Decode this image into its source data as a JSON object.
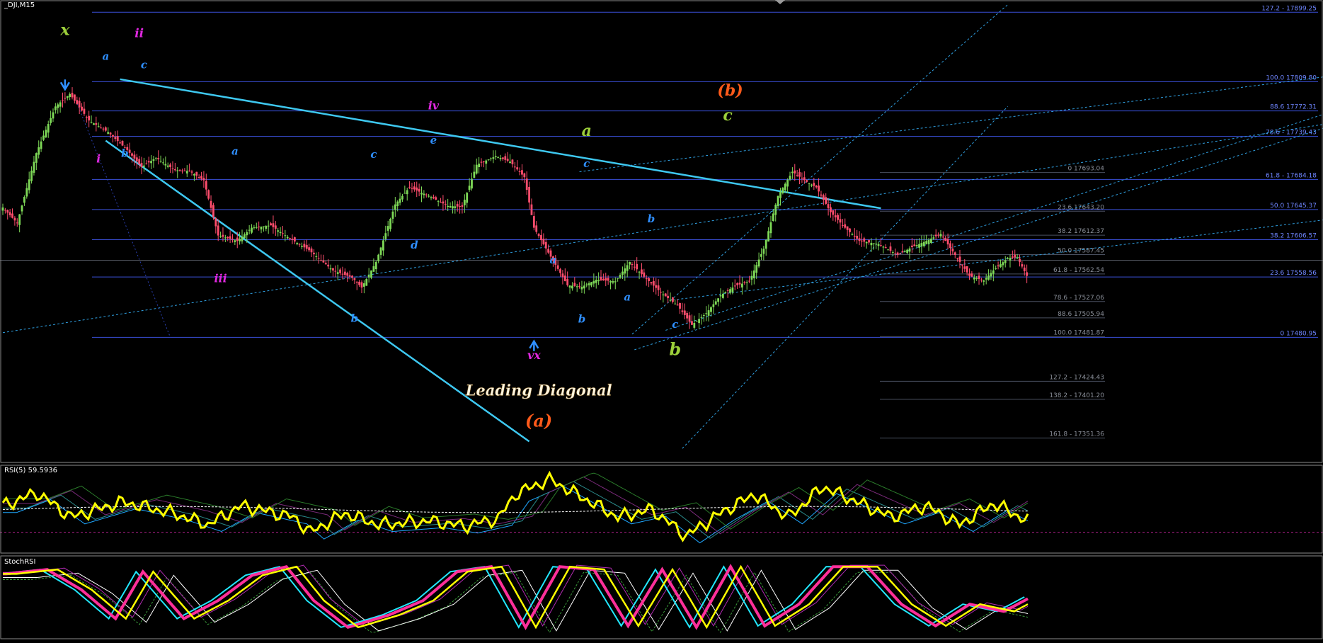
{
  "window": {
    "symbol_timeframe": "_DJI,M15"
  },
  "colors": {
    "background": "#000000",
    "bull": "#7ed957",
    "bear": "#ff4d6d",
    "fib_line": "#3a4fd8",
    "fib_label_blue": "#6f86ff",
    "fib_label_gray": "#8a8f99",
    "trend": "#3ec8f0",
    "channel_dash": "#2f9fe0",
    "wave_blue": "#2f8fff",
    "wave_magenta": "#e028e0",
    "wave_green": "#9ccf3a",
    "wave_orange": "#ff5a1a",
    "rsi_line": "#ffff00",
    "stoch_main": "#ff2f9a",
    "stoch_signal": "#ffff00",
    "stoch_cyan": "#22e8ff",
    "panel_border": "#8c8c8c"
  },
  "chart_data": [
    {
      "type": "candlestick",
      "title": "_DJI,M15",
      "ylim": [
        17320,
        17915
      ],
      "fib_levels_left": [
        {
          "label": "127.2 - 17899.25",
          "value": 17899.25
        },
        {
          "label": "100.0 17809.80",
          "value": 17809.8
        },
        {
          "label": "88.6 17772.31",
          "value": 17772.31
        },
        {
          "label": "78.6 - 17739.43",
          "value": 17739.43
        },
        {
          "label": "61.8 - 17684.18",
          "value": 17684.18
        },
        {
          "label": "50.0 17645.37",
          "value": 17645.37
        },
        {
          "label": "38.2 17606.57",
          "value": 17606.57
        },
        {
          "label": "23.6 17558.56",
          "value": 17558.56
        },
        {
          "label": "0 17480.95",
          "value": 17480.95
        }
      ],
      "fib_levels_right": [
        {
          "label": "0 17693.04",
          "value": 17693.04
        },
        {
          "label": "23.6 17643.20",
          "value": 17643.2
        },
        {
          "label": "38.2 17612.37",
          "value": 17612.37
        },
        {
          "label": "50.0 17587.45",
          "value": 17587.45
        },
        {
          "label": "61.8 - 17562.54",
          "value": 17562.54
        },
        {
          "label": "78.6 - 17527.06",
          "value": 17527.06
        },
        {
          "label": "88.6 17505.94",
          "value": 17505.94
        },
        {
          "label": "100.0 17481.87",
          "value": 17481.87
        },
        {
          "label": "127.2 - 17424.43",
          "value": 17424.43
        },
        {
          "label": "138.2 - 17401.20",
          "value": 17401.2
        },
        {
          "label": "161.8 - 17351.36",
          "value": 17351.36
        }
      ],
      "current_price": 17580,
      "close_path": [
        [
          0,
          17648
        ],
        [
          6,
          17628
        ],
        [
          14,
          17718
        ],
        [
          22,
          17778
        ],
        [
          28,
          17794
        ],
        [
          36,
          17760
        ],
        [
          44,
          17745
        ],
        [
          52,
          17722
        ],
        [
          58,
          17700
        ],
        [
          64,
          17712
        ],
        [
          72,
          17696
        ],
        [
          78,
          17695
        ],
        [
          84,
          17683
        ],
        [
          90,
          17612
        ],
        [
          98,
          17605
        ],
        [
          104,
          17622
        ],
        [
          112,
          17625
        ],
        [
          120,
          17608
        ],
        [
          128,
          17593
        ],
        [
          138,
          17567
        ],
        [
          146,
          17558
        ],
        [
          150,
          17545
        ],
        [
          156,
          17578
        ],
        [
          164,
          17652
        ],
        [
          170,
          17674
        ],
        [
          178,
          17663
        ],
        [
          186,
          17650
        ],
        [
          192,
          17649
        ],
        [
          198,
          17703
        ],
        [
          206,
          17714
        ],
        [
          212,
          17707
        ],
        [
          218,
          17687
        ],
        [
          222,
          17622
        ],
        [
          228,
          17590
        ],
        [
          236,
          17548
        ],
        [
          242,
          17546
        ],
        [
          248,
          17555
        ],
        [
          256,
          17553
        ],
        [
          262,
          17578
        ],
        [
          268,
          17559
        ],
        [
          276,
          17536
        ],
        [
          282,
          17522
        ],
        [
          288,
          17497
        ],
        [
          294,
          17512
        ],
        [
          300,
          17535
        ],
        [
          306,
          17547
        ],
        [
          312,
          17553
        ],
        [
          318,
          17595
        ],
        [
          324,
          17663
        ],
        [
          330,
          17694
        ],
        [
          336,
          17681
        ],
        [
          340,
          17674
        ],
        [
          346,
          17642
        ],
        [
          352,
          17622
        ],
        [
          358,
          17605
        ],
        [
          366,
          17601
        ],
        [
          374,
          17587
        ],
        [
          380,
          17597
        ],
        [
          386,
          17605
        ],
        [
          392,
          17614
        ],
        [
          398,
          17587
        ],
        [
          404,
          17560
        ],
        [
          410,
          17554
        ],
        [
          414,
          17567
        ],
        [
          420,
          17583
        ],
        [
          424,
          17584
        ],
        [
          428,
          17560
        ]
      ],
      "wave_labels": [
        {
          "text": "x",
          "color": "wave_green",
          "i": 26,
          "v": 17870,
          "size": 22
        },
        {
          "text": "ii",
          "color": "wave_magenta",
          "i": 57,
          "v": 17867,
          "size": 17
        },
        {
          "text": "a",
          "color": "wave_blue",
          "i": 43,
          "v": 17838,
          "size": 15
        },
        {
          "text": "c",
          "color": "wave_blue",
          "i": 59,
          "v": 17827,
          "size": 15
        },
        {
          "text": "i",
          "color": "wave_magenta",
          "i": 40,
          "v": 17706,
          "size": 16
        },
        {
          "text": "b",
          "color": "wave_blue",
          "i": 51,
          "v": 17713,
          "size": 15
        },
        {
          "text": "a",
          "color": "wave_blue",
          "i": 97,
          "v": 17716,
          "size": 15
        },
        {
          "text": "iii",
          "color": "wave_magenta",
          "i": 91,
          "v": 17552,
          "size": 16
        },
        {
          "text": "b",
          "color": "wave_blue",
          "i": 147,
          "v": 17501,
          "size": 15
        },
        {
          "text": "c",
          "color": "wave_blue",
          "i": 155,
          "v": 17712,
          "size": 15
        },
        {
          "text": "d",
          "color": "wave_blue",
          "i": 172,
          "v": 17595,
          "size": 15
        },
        {
          "text": "iv",
          "color": "wave_magenta",
          "i": 180,
          "v": 17774,
          "size": 16
        },
        {
          "text": "e",
          "color": "wave_blue",
          "i": 180,
          "v": 17730,
          "size": 15
        },
        {
          "text": "a",
          "color": "wave_blue",
          "i": 230,
          "v": 17576,
          "size": 15
        },
        {
          "text": "b",
          "color": "wave_blue",
          "i": 242,
          "v": 17500,
          "size": 15
        },
        {
          "text": "vx",
          "color": "wave_magenta",
          "i": 222,
          "v": 17453,
          "size": 16
        },
        {
          "text": "a",
          "color": "wave_green",
          "i": 244,
          "v": 17740,
          "size": 22
        },
        {
          "text": "c",
          "color": "wave_blue",
          "i": 244,
          "v": 17700,
          "size": 15
        },
        {
          "text": "a",
          "color": "wave_blue",
          "i": 261,
          "v": 17528,
          "size": 15
        },
        {
          "text": "b",
          "color": "wave_blue",
          "i": 271,
          "v": 17629,
          "size": 15
        },
        {
          "text": "c",
          "color": "wave_blue",
          "i": 281,
          "v": 17493,
          "size": 15
        },
        {
          "text": "b",
          "color": "wave_green",
          "i": 281,
          "v": 17458,
          "size": 24
        },
        {
          "text": "(b)",
          "color": "wave_orange",
          "i": 304,
          "v": 17792,
          "size": 22
        },
        {
          "text": "c",
          "color": "wave_green",
          "i": 303,
          "v": 17760,
          "size": 22
        },
        {
          "text": "(a)",
          "color": "wave_orange",
          "i": 224,
          "v": 17366,
          "size": 24
        }
      ],
      "annotations": [
        {
          "text": "Leading Diagonal",
          "color": "#fff5df",
          "i": 224,
          "v": 17406
        }
      ]
    },
    {
      "type": "line",
      "title": "RSI(5) 59.5936",
      "ylim": [
        0,
        100
      ],
      "series": [
        {
          "values_path": [
            [
              0,
              55
            ],
            [
              10,
              72
            ],
            [
              20,
              40
            ],
            [
              35,
              60
            ],
            [
              50,
              45
            ],
            [
              60,
              30
            ],
            [
              70,
              55
            ],
            [
              85,
              40
            ],
            [
              90,
              20
            ],
            [
              100,
              45
            ],
            [
              110,
              30
            ],
            [
              125,
              35
            ],
            [
              135,
              28
            ],
            [
              145,
              38
            ],
            [
              150,
              70
            ],
            [
              160,
              90
            ],
            [
              170,
              65
            ],
            [
              180,
              40
            ],
            [
              190,
              50
            ],
            [
              200,
              15
            ],
            [
              210,
              45
            ],
            [
              220,
              70
            ],
            [
              230,
              40
            ],
            [
              240,
              80
            ],
            [
              250,
              60
            ],
            [
              260,
              40
            ],
            [
              270,
              55
            ],
            [
              280,
              30
            ],
            [
              290,
              58
            ],
            [
              300,
              35
            ]
          ]
        }
      ]
    },
    {
      "type": "line",
      "title": "StochRSI",
      "ylim": [
        0,
        100
      ],
      "series": [
        {
          "values_path": [
            [
              0,
              82
            ],
            [
              12,
              88
            ],
            [
              22,
              60
            ],
            [
              32,
              20
            ],
            [
              40,
              85
            ],
            [
              52,
              20
            ],
            [
              62,
              45
            ],
            [
              72,
              80
            ],
            [
              82,
              92
            ],
            [
              90,
              45
            ],
            [
              100,
              8
            ],
            [
              112,
              25
            ],
            [
              122,
              45
            ],
            [
              132,
              85
            ],
            [
              142,
              92
            ],
            [
              152,
              8
            ],
            [
              162,
              92
            ],
            [
              172,
              88
            ],
            [
              182,
              10
            ],
            [
              192,
              88
            ],
            [
              202,
              8
            ],
            [
              212,
              92
            ],
            [
              222,
              10
            ],
            [
              232,
              40
            ],
            [
              242,
              92
            ],
            [
              252,
              92
            ],
            [
              262,
              40
            ],
            [
              272,
              10
            ],
            [
              282,
              40
            ],
            [
              292,
              30
            ],
            [
              300,
              50
            ]
          ]
        }
      ]
    }
  ]
}
